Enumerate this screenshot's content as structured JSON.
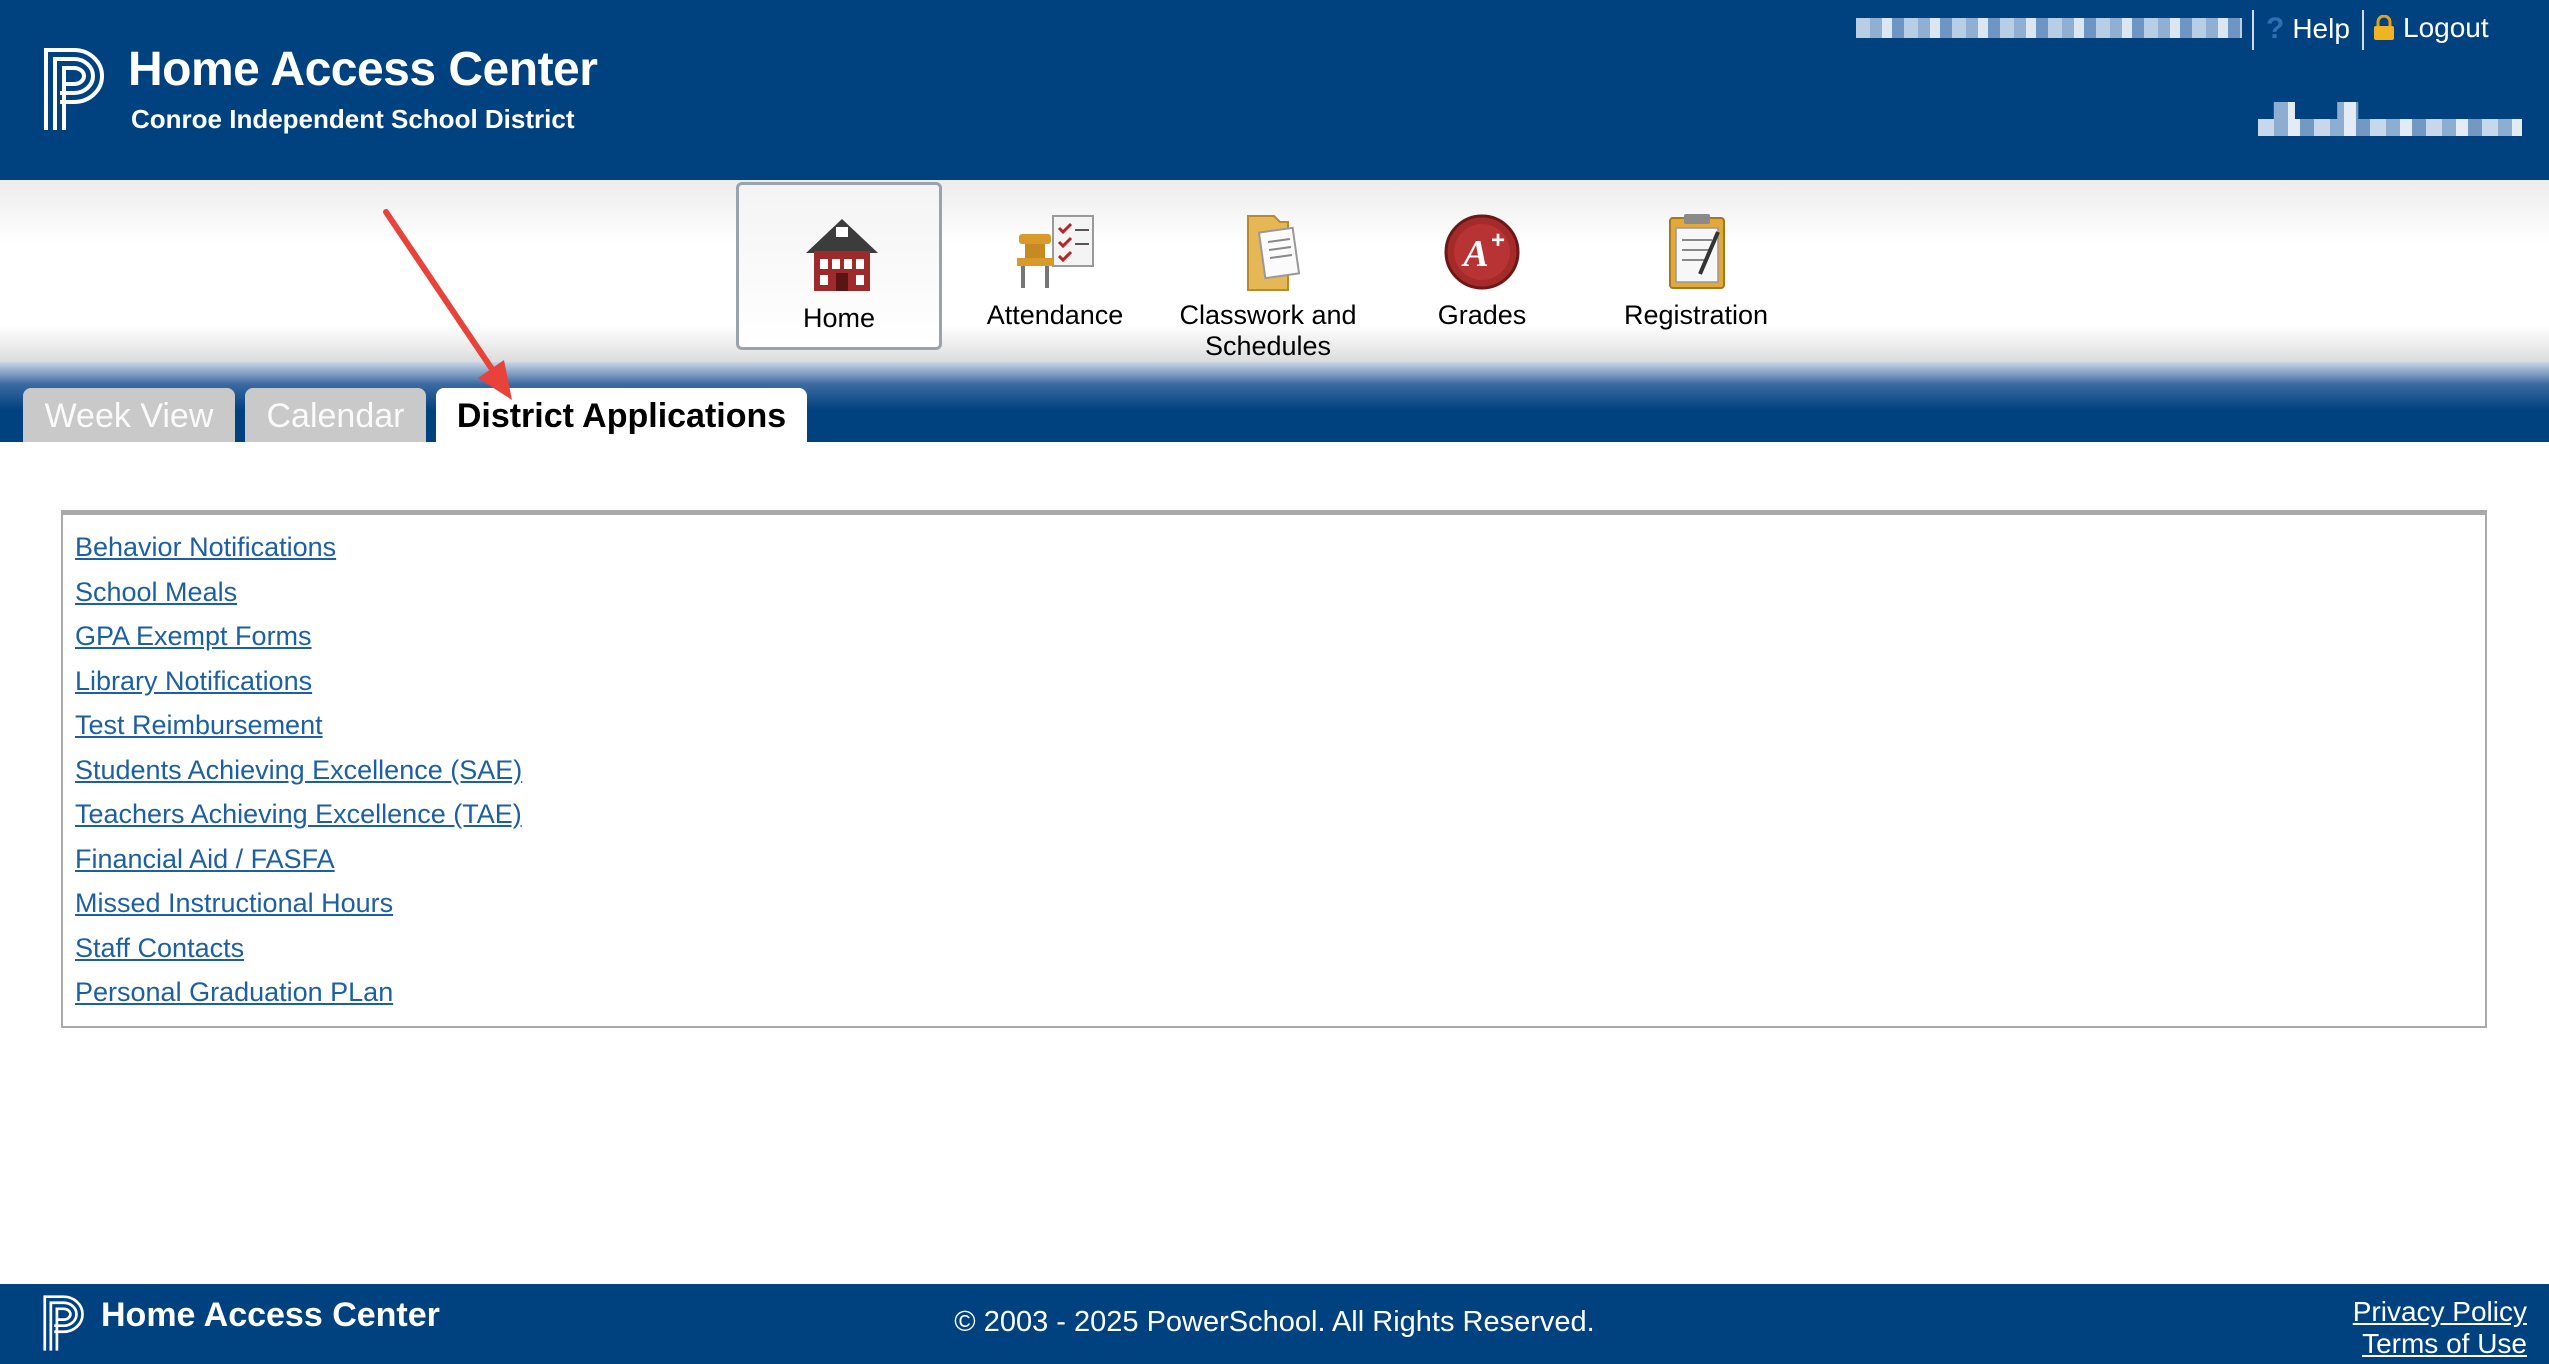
{
  "header": {
    "app_title": "Home Access Center",
    "district": "Conroe Independent School District",
    "help_label": "Help",
    "logout_label": "Logout"
  },
  "nav": [
    {
      "label": "Home",
      "icon": "schoolhouse-icon"
    },
    {
      "label": "Attendance",
      "icon": "desk-checklist-icon"
    },
    {
      "label": "Classwork and Schedules",
      "icon": "folder-documents-icon"
    },
    {
      "label": "Grades",
      "icon": "a-plus-icon"
    },
    {
      "label": "Registration",
      "icon": "clipboard-icon"
    }
  ],
  "tabs": [
    "Week View",
    "Calendar",
    "District Applications"
  ],
  "district_applications": [
    "Behavior Notifications",
    "School Meals",
    "GPA Exempt Forms",
    "Library Notifications",
    "Test Reimbursement",
    "Students Achieving Excellence (SAE)",
    "Teachers Achieving Excellence (TAE)",
    "Financial Aid / FASFA",
    "Missed Instructional Hours",
    "Staff Contacts",
    "Personal Graduation PLan"
  ],
  "footer": {
    "app_title": "Home Access Center",
    "copyright": "© 2003 - 2025 PowerSchool. All Rights Reserved.",
    "privacy_label": "Privacy Policy",
    "terms_label": "Terms of Use"
  },
  "colors": {
    "brand": "#004280",
    "link": "#1d5fa3",
    "annotation_arrow": "#e8423b"
  }
}
